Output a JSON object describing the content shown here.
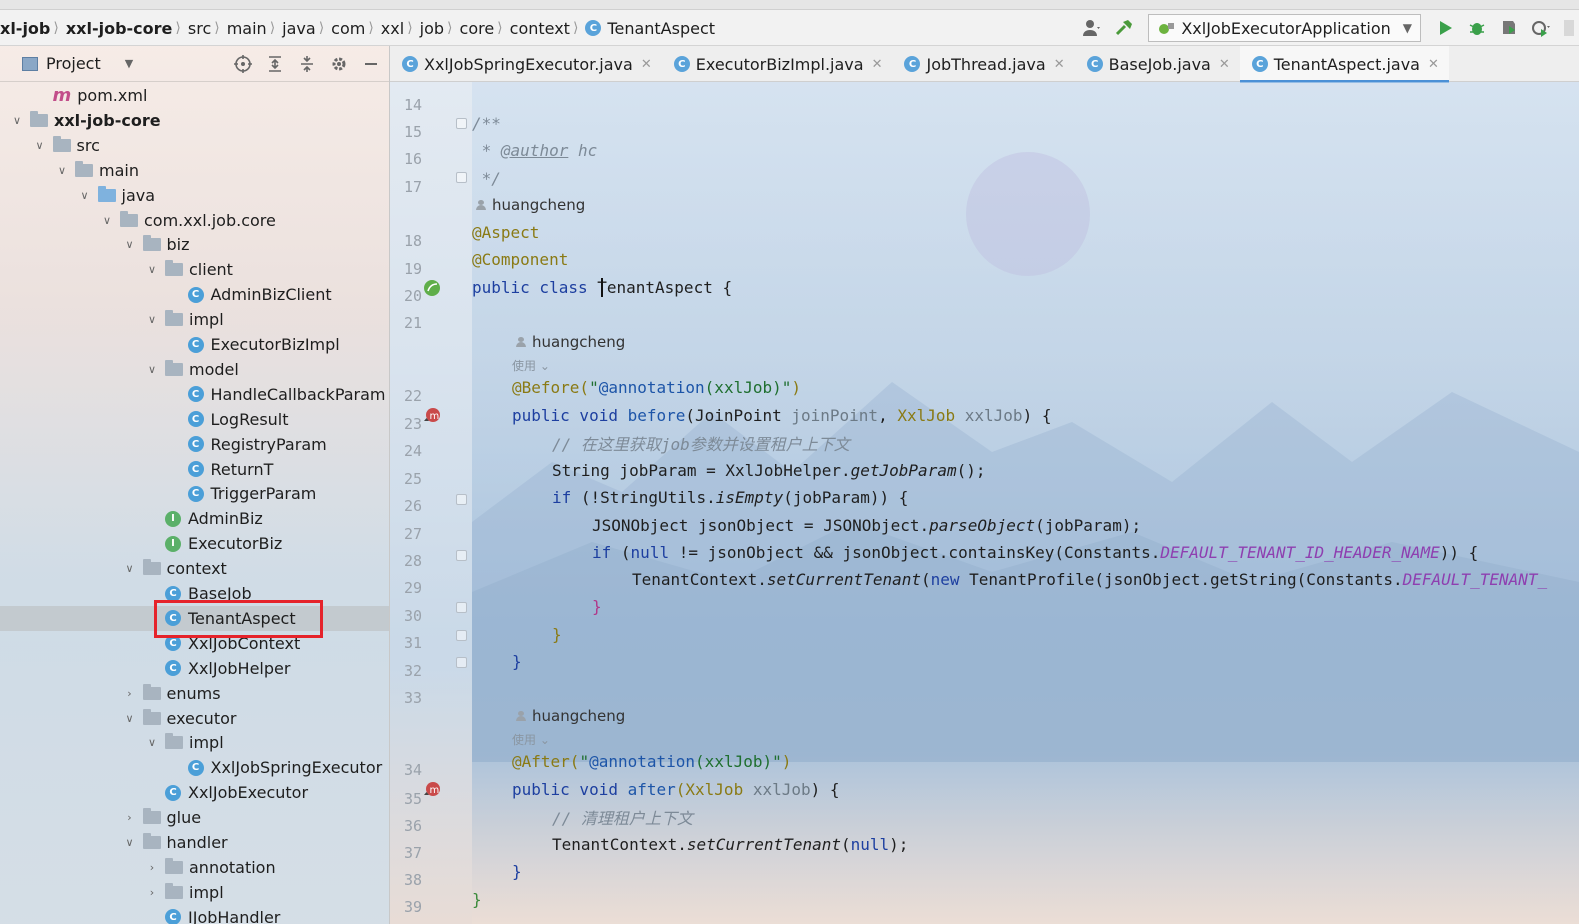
{
  "breadcrumbs": [
    {
      "label": "xl-job",
      "bold": true
    },
    {
      "label": "xxl-job-core",
      "bold": true
    },
    {
      "label": "src"
    },
    {
      "label": "main"
    },
    {
      "label": "java"
    },
    {
      "label": "com"
    },
    {
      "label": "xxl"
    },
    {
      "label": "job"
    },
    {
      "label": "core"
    },
    {
      "label": "context"
    },
    {
      "label": "TenantAspect",
      "icon": "class-icon"
    }
  ],
  "toolbar": {
    "run_config": "XxlJobExecutorApplication",
    "icons": [
      "user-icon",
      "build-hammer-icon",
      "run-icon",
      "debug-icon",
      "coverage-icon",
      "profile-icon",
      "more-icon"
    ]
  },
  "project_panel": {
    "title": "Project",
    "tree": [
      {
        "label": "pom.xml",
        "depth": 1,
        "kind": "maven"
      },
      {
        "label": "xxl-job-core",
        "depth": 0,
        "kind": "module",
        "expanded": true,
        "bold": true
      },
      {
        "label": "src",
        "depth": 1,
        "kind": "folder",
        "expanded": true
      },
      {
        "label": "main",
        "depth": 2,
        "kind": "folder",
        "expanded": true
      },
      {
        "label": "java",
        "depth": 3,
        "kind": "folder-blue",
        "expanded": true
      },
      {
        "label": "com.xxl.job.core",
        "depth": 4,
        "kind": "folder",
        "expanded": true
      },
      {
        "label": "biz",
        "depth": 5,
        "kind": "folder",
        "expanded": true
      },
      {
        "label": "client",
        "depth": 6,
        "kind": "folder",
        "expanded": true
      },
      {
        "label": "AdminBizClient",
        "depth": 7,
        "kind": "class"
      },
      {
        "label": "impl",
        "depth": 6,
        "kind": "folder",
        "expanded": true
      },
      {
        "label": "ExecutorBizImpl",
        "depth": 7,
        "kind": "class"
      },
      {
        "label": "model",
        "depth": 6,
        "kind": "folder",
        "expanded": true
      },
      {
        "label": "HandleCallbackParam",
        "depth": 7,
        "kind": "class"
      },
      {
        "label": "LogResult",
        "depth": 7,
        "kind": "class"
      },
      {
        "label": "RegistryParam",
        "depth": 7,
        "kind": "class"
      },
      {
        "label": "ReturnT",
        "depth": 7,
        "kind": "class"
      },
      {
        "label": "TriggerParam",
        "depth": 7,
        "kind": "class"
      },
      {
        "label": "AdminBiz",
        "depth": 6,
        "kind": "interface"
      },
      {
        "label": "ExecutorBiz",
        "depth": 6,
        "kind": "interface"
      },
      {
        "label": "context",
        "depth": 5,
        "kind": "folder",
        "expanded": true
      },
      {
        "label": "BaseJob",
        "depth": 6,
        "kind": "class"
      },
      {
        "label": "TenantAspect",
        "depth": 6,
        "kind": "class",
        "selected": true
      },
      {
        "label": "XxlJobContext",
        "depth": 6,
        "kind": "class"
      },
      {
        "label": "XxlJobHelper",
        "depth": 6,
        "kind": "class"
      },
      {
        "label": "enums",
        "depth": 5,
        "kind": "folder",
        "expanded": false
      },
      {
        "label": "executor",
        "depth": 5,
        "kind": "folder",
        "expanded": true
      },
      {
        "label": "impl",
        "depth": 6,
        "kind": "folder",
        "expanded": true
      },
      {
        "label": "XxlJobSpringExecutor",
        "depth": 7,
        "kind": "class"
      },
      {
        "label": "XxlJobExecutor",
        "depth": 6,
        "kind": "class"
      },
      {
        "label": "glue",
        "depth": 5,
        "kind": "folder",
        "expanded": false
      },
      {
        "label": "handler",
        "depth": 5,
        "kind": "folder",
        "expanded": true
      },
      {
        "label": "annotation",
        "depth": 6,
        "kind": "folder",
        "expanded": false
      },
      {
        "label": "impl",
        "depth": 6,
        "kind": "folder",
        "expanded": false
      },
      {
        "label": "IJobHandler",
        "depth": 6,
        "kind": "class"
      }
    ]
  },
  "tabs": [
    {
      "label": "XxlJobSpringExecutor.java"
    },
    {
      "label": "ExecutorBizImpl.java"
    },
    {
      "label": "JobThread.java"
    },
    {
      "label": "BaseJob.java"
    },
    {
      "label": "TenantAspect.java",
      "active": true
    }
  ],
  "gutter": {
    "line_numbers": [
      "14",
      "15",
      "16",
      "17",
      "18",
      "19",
      "20",
      "21",
      "22",
      "23",
      "24",
      "25",
      "26",
      "27",
      "28",
      "29",
      "30",
      "31",
      "32",
      "33",
      "34",
      "35",
      "36",
      "37",
      "38",
      "39"
    ]
  },
  "code": {
    "javadoc_open": "/**",
    "javadoc_star": " * ",
    "javadoc_author_tag": "@author",
    "javadoc_author": " hc",
    "javadoc_close": " */",
    "hint_author_1": "huangcheng",
    "ann_aspect": "@Aspect",
    "ann_component": "@Component",
    "class_kw": "public class ",
    "class_name": "TenantAspect",
    "class_brace": " {",
    "hint_author_2": "huangcheng",
    "hint_sub_2": "使用",
    "before_ann": "@Before(",
    "before_str_1": "\"",
    "before_str_2": "@annotation",
    "before_str_3": "(xxlJob)\"",
    "before_close": ")",
    "before_sig_kw": "public void ",
    "before_sig_name": "before",
    "before_sig_p1_type": "(JoinPoint ",
    "before_sig_p1": "joinPoint",
    "before_sig_sep": ", ",
    "before_sig_p2_type": "XxlJob ",
    "before_sig_p2": "xxlJob",
    "before_sig_end": ") {",
    "comment_1": "// 在这里获取job参数并设置租户上下文",
    "line_26_a": "String jobParam = XxlJobHelper.",
    "line_26_b": "getJobParam",
    "line_26_c": "();",
    "line_27_kw": "if ",
    "line_27_a": "(!StringUtils.",
    "line_27_b": "isEmpty",
    "line_27_c": "(jobParam)) {",
    "line_28_a": "JSONObject jsonObject = JSONObject.",
    "line_28_b": "parseObject",
    "line_28_c": "(jobParam);",
    "line_29_kw": "if ",
    "line_29_a": "(",
    "line_29_null": "null",
    "line_29_b": " != jsonObject && jsonObject.containsKey(Constants.",
    "line_29_const": "DEFAULT_TENANT_ID_HEADER_NAME",
    "line_29_c": ")) {",
    "line_30_a": "TenantContext.",
    "line_30_b": "setCurrentTenant",
    "line_30_c": "(",
    "line_30_new": "new ",
    "line_30_d": "TenantProfile(jsonObject.getString(Constants.",
    "line_30_const": "DEFAULT_TENANT_",
    "close_brace": "}",
    "hint_author_3": "huangcheng",
    "hint_sub_3": "使用",
    "after_ann": "@After(",
    "after_str_1": "\"",
    "after_str_2": "@annotation",
    "after_str_3": "(xxlJob)\"",
    "after_close": ")",
    "after_sig_kw": "public void ",
    "after_sig_name": "after",
    "after_sig_p_type": "(XxlJob ",
    "after_sig_p": "xxlJob",
    "after_sig_end": ") {",
    "comment_2": "// 清理租户上下文",
    "line_37_a": "TenantContext.",
    "line_37_b": "setCurrentTenant",
    "line_37_c": "(",
    "line_37_null": "null",
    "line_37_d": ");"
  },
  "colors": {
    "highlight_box": "#e5232b",
    "keyword": "#1d3fa0",
    "annotation": "#8a7a14",
    "constant": "#8e3fb0",
    "string": "#1f6f2f"
  }
}
